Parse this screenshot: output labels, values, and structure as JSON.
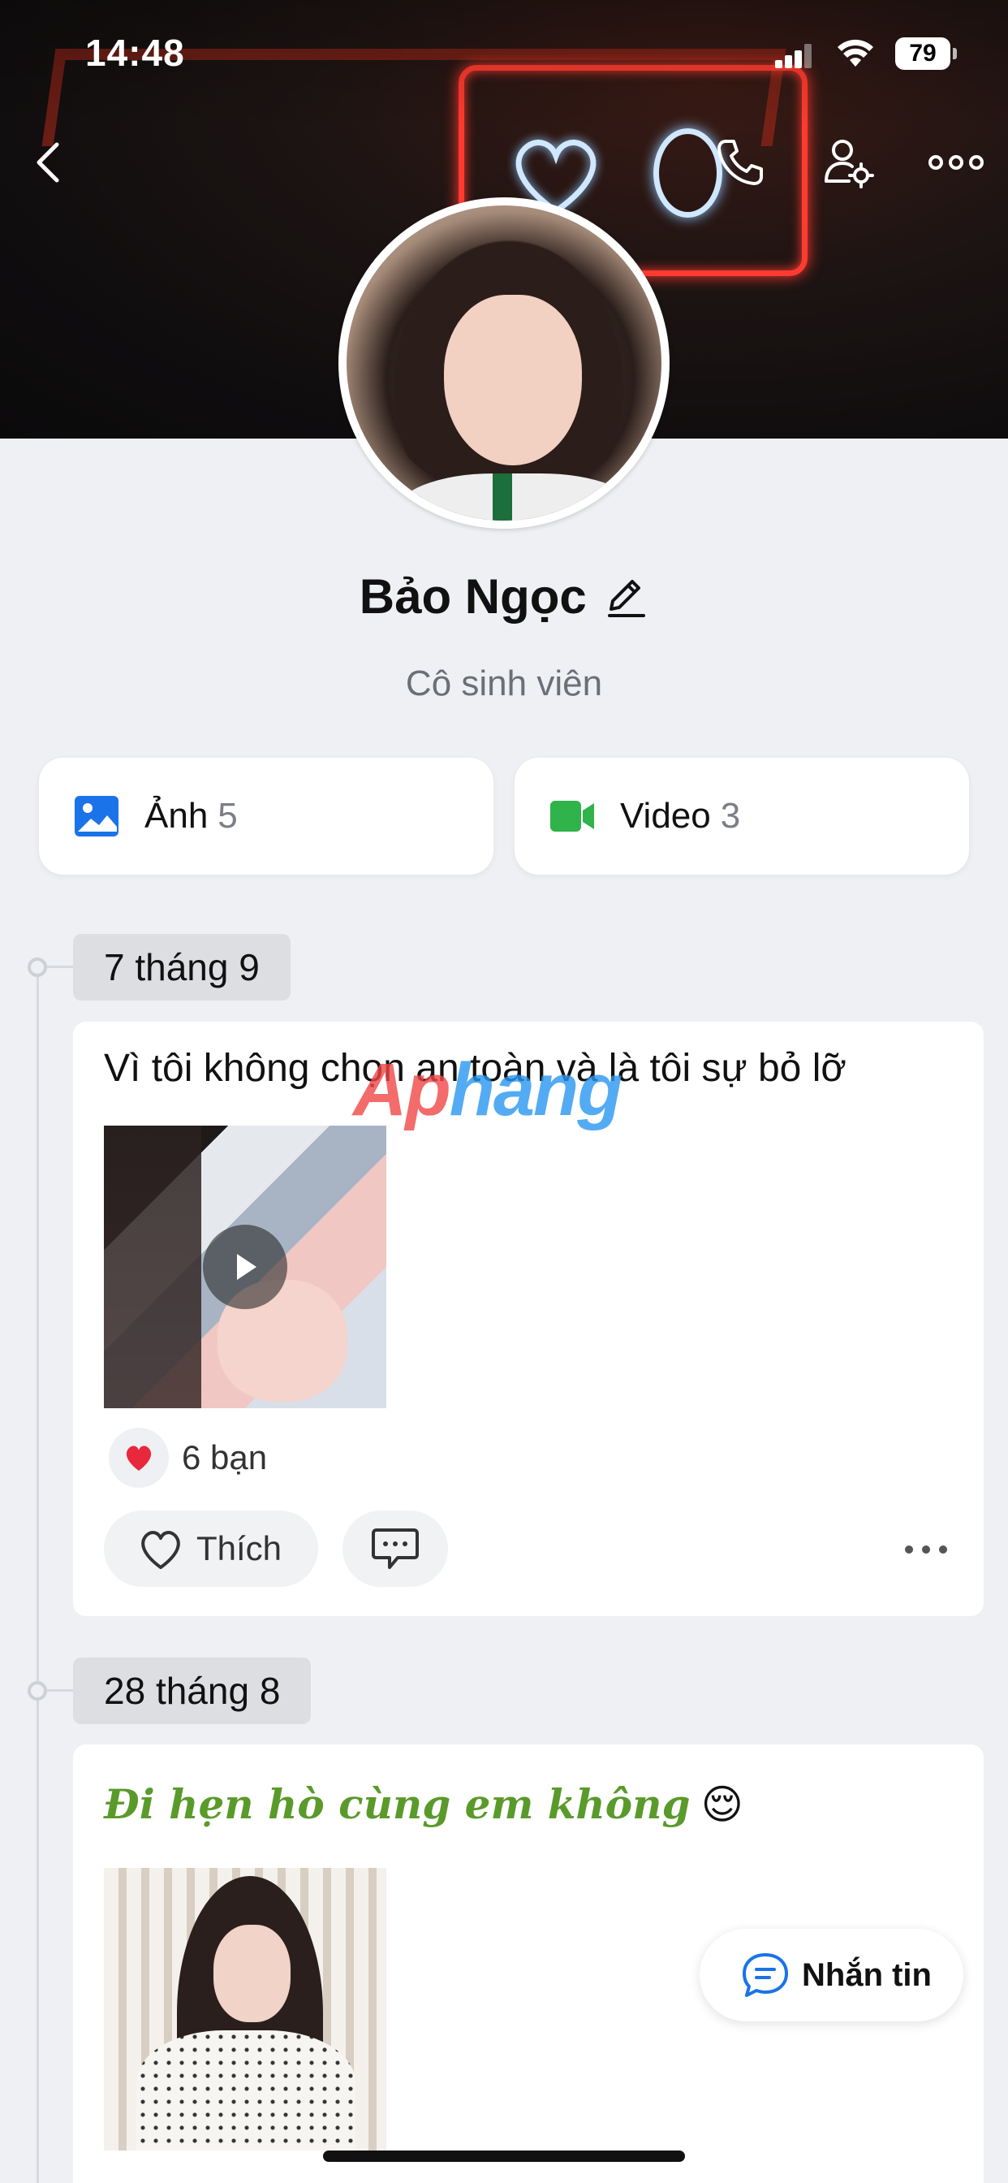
{
  "status_bar": {
    "time": "14:48",
    "battery": "79"
  },
  "profile": {
    "name": "Bảo Ngọc",
    "bio": "Cô sinh viên"
  },
  "media": [
    {
      "label": "Ảnh",
      "count": "5",
      "icon": "photo-icon",
      "color": "#1a73e8"
    },
    {
      "label": "Video",
      "count": "3",
      "icon": "video-camera-icon",
      "color": "#2fb34a"
    }
  ],
  "watermark": {
    "part1": "Ap",
    "part2": "hang"
  },
  "posts": [
    {
      "date": "7 tháng 9",
      "text": "Vì tôi không chọn an toàn và là tôi sự bỏ lỡ",
      "media_type": "video",
      "reaction_count": "6 bạn",
      "like_label": "Thích"
    },
    {
      "date": "28 tháng 8",
      "text": "Đi hẹn hò cùng em không",
      "emoji": "😌",
      "media_type": "photo"
    }
  ],
  "floating": {
    "message_label": "Nhắn tin"
  },
  "colors": {
    "accent_blue": "#1a73e8",
    "heart_red": "#e8283c",
    "fancy_green": "#5a9a2a"
  }
}
